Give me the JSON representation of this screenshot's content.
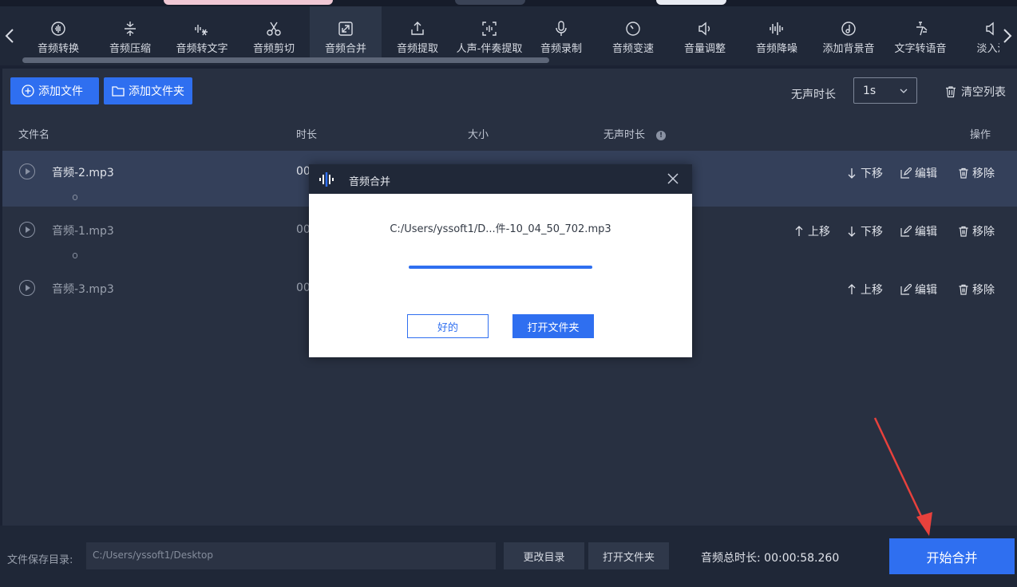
{
  "colors": {
    "accent": "#2f6ff0",
    "panel": "#283041",
    "toolbar": "#202838",
    "annotation_arrow": "#e8413c"
  },
  "toolbar": {
    "prev_icon": "chevron-left-icon",
    "next_icon": "chevron-right-icon",
    "tools": [
      {
        "label": "音频转换",
        "icon": "audio-convert-icon"
      },
      {
        "label": "音频压缩",
        "icon": "compress-icon"
      },
      {
        "label": "音频转文字",
        "icon": "speech-to-text-icon"
      },
      {
        "label": "音频剪切",
        "icon": "scissors-icon"
      },
      {
        "label": "音频合并",
        "icon": "merge-icon",
        "active": true
      },
      {
        "label": "音频提取",
        "icon": "upload-icon"
      },
      {
        "label": "人声-伴奏提取",
        "icon": "voice-extract-icon"
      },
      {
        "label": "音频录制",
        "icon": "microphone-icon"
      },
      {
        "label": "音频变速",
        "icon": "speed-icon"
      },
      {
        "label": "音量调整",
        "icon": "volume-icon"
      },
      {
        "label": "音频降噪",
        "icon": "waveform-icon"
      },
      {
        "label": "添加背景音",
        "icon": "music-note-icon"
      },
      {
        "label": "文字转语音",
        "icon": "text-to-speech-icon"
      },
      {
        "label": "淡入淡",
        "icon": "fade-icon"
      }
    ]
  },
  "actions": {
    "add_file": "添加文件",
    "add_folder": "添加文件夹",
    "silence_label": "无声时长",
    "silence_value": "1s",
    "clear_list": "清空列表"
  },
  "table": {
    "headers": {
      "name": "文件名",
      "duration": "时长",
      "size": "大小",
      "silence": "无声时长",
      "ops": "操作",
      "info": "!"
    },
    "rows": [
      {
        "name": "音频-2.mp3",
        "duration": "00"
      },
      {
        "name": "音频-1.mp3",
        "duration": "00"
      },
      {
        "name": "音频-3.mp3",
        "duration": "00"
      }
    ],
    "ops": {
      "down": "下移",
      "up": "上移",
      "edit": "编辑",
      "remove": "移除"
    }
  },
  "footer": {
    "save_dir_label": "文件保存目录:",
    "save_dir_value": "C:/Users/yssoft1/Desktop",
    "change_dir": "更改目录",
    "open_folder": "打开文件夹",
    "total_label": "音频总时长:",
    "total_value": "00:00:58.260",
    "start": "开始合并"
  },
  "modal": {
    "title": "音频合并",
    "message": "C:/Users/yssoft1/D...件-10_04_50_702.mp3",
    "progress_percent": 100,
    "ok": "好的",
    "open_folder": "打开文件夹"
  }
}
